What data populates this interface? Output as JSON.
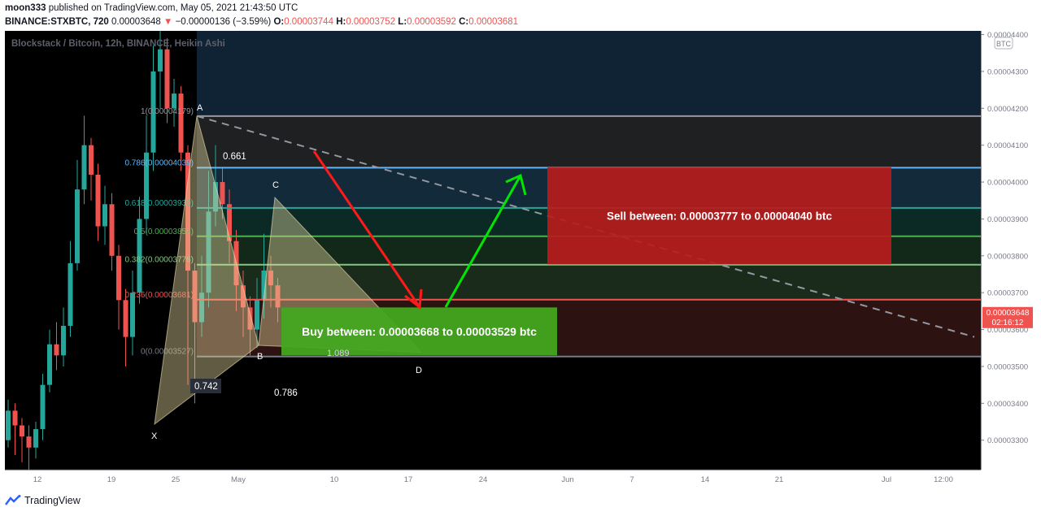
{
  "header": {
    "publisher": "moon333",
    "published_text": "published on TradingView.com, May 05, 2021 21:43:50 UTC",
    "symbol": "BINANCE:STXBTC, 720",
    "last": "0.00003648",
    "change": "−0.00000136 (−3.59%)",
    "o_label": "O:",
    "o": "0.00003744",
    "h_label": "H:",
    "h": "0.00003752",
    "l_label": "L:",
    "l": "0.00003592",
    "c_label": "C:",
    "c": "0.00003681"
  },
  "footer": {
    "brand": "TradingView"
  },
  "colors": {
    "up": "#26a69a",
    "down": "#ef5350",
    "buy": "#4caf50",
    "sell": "#c62828",
    "arrow_up": "#00e600",
    "arrow_down": "#ff1a1a"
  },
  "chart_data": {
    "type": "candlestick",
    "title": "Blockstack / Bitcoin, 12h, BINANCE, Heikin Ashi",
    "currency_badge": "BTC",
    "y_axis": {
      "range": [
        3.22e-05,
        4.41e-05
      ],
      "ticks": [
        "0.00003300",
        "0.00003400",
        "0.00003500",
        "0.00003600",
        "0.00003700",
        "0.00003800",
        "0.00003900",
        "0.00004000",
        "0.00004100",
        "0.00004200",
        "0.00004300",
        "0.00004400"
      ]
    },
    "x_axis": {
      "ticks": [
        "12",
        "19",
        "25",
        "May",
        "10",
        "17",
        "24",
        "Jun",
        "7",
        "14",
        "21",
        "Jul",
        "12:00"
      ]
    },
    "last_price_label": "0.00003648",
    "countdown_label": "02:16:12",
    "fib_levels": [
      {
        "label": "0.786(0.00004039)",
        "ratio": "0.786",
        "value": 4.039e-05,
        "color": "#64b5f6"
      },
      {
        "label": "0.618(0.00003930)",
        "ratio": "0.618",
        "value": 3.93e-05,
        "color": "#26a69a"
      },
      {
        "label": "0.5(0.00003853)",
        "ratio": "0.5",
        "value": 3.853e-05,
        "color": "#4caf50"
      },
      {
        "label": "0.382(0.00003776)",
        "ratio": "0.382",
        "value": 3.776e-05,
        "color": "#81c784"
      },
      {
        "label": "0.236(0.00003681)",
        "ratio": "0.236",
        "value": 3.681e-05,
        "color": "#ef5350"
      },
      {
        "label": "0(0.00003527)",
        "ratio": "0",
        "value": 3.527e-05,
        "color": "#787b86"
      }
    ],
    "fib_top_label": "1(0.00004179)",
    "fib_top_value": 4.179e-05,
    "pattern_points": [
      "X",
      "A",
      "B",
      "C",
      "D"
    ],
    "pattern_ratios": [
      "0.661",
      "0.742",
      "0.786",
      "1.089"
    ],
    "sell_label": "Sell between: 0.00003777 to 0.00004040 btc",
    "buy_label": "Buy between: 0.00003668 to 0.00003529 btc",
    "candles": [
      {
        "o": 3.3e-05,
        "c": 3.38e-05,
        "h": 3.41e-05,
        "l": 3.28e-05
      },
      {
        "o": 3.38e-05,
        "c": 3.34e-05,
        "h": 3.4e-05,
        "l": 3.26e-05
      },
      {
        "o": 3.34e-05,
        "c": 3.31e-05,
        "h": 3.36e-05,
        "l": 3.24e-05
      },
      {
        "o": 3.31e-05,
        "c": 3.28e-05,
        "h": 3.34e-05,
        "l": 3.22e-05
      },
      {
        "o": 3.28e-05,
        "c": 3.33e-05,
        "h": 3.35e-05,
        "l": 3.25e-05
      },
      {
        "o": 3.33e-05,
        "c": 3.45e-05,
        "h": 3.48e-05,
        "l": 3.3e-05
      },
      {
        "o": 3.45e-05,
        "c": 3.56e-05,
        "h": 3.6e-05,
        "l": 3.43e-05
      },
      {
        "o": 3.56e-05,
        "c": 3.53e-05,
        "h": 3.62e-05,
        "l": 3.49e-05
      },
      {
        "o": 3.53e-05,
        "c": 3.61e-05,
        "h": 3.66e-05,
        "l": 3.5e-05
      },
      {
        "o": 3.61e-05,
        "c": 3.78e-05,
        "h": 3.84e-05,
        "l": 3.58e-05
      },
      {
        "o": 3.78e-05,
        "c": 3.98e-05,
        "h": 4.06e-05,
        "l": 3.76e-05
      },
      {
        "o": 3.98e-05,
        "c": 4.1e-05,
        "h": 4.18e-05,
        "l": 3.94e-05
      },
      {
        "o": 4.1e-05,
        "c": 4.02e-05,
        "h": 4.12e-05,
        "l": 3.95e-05
      },
      {
        "o": 4.02e-05,
        "c": 3.88e-05,
        "h": 4.05e-05,
        "l": 3.84e-05
      },
      {
        "o": 3.88e-05,
        "c": 3.94e-05,
        "h": 3.99e-05,
        "l": 3.83e-05
      },
      {
        "o": 3.94e-05,
        "c": 3.8e-05,
        "h": 3.97e-05,
        "l": 3.76e-05
      },
      {
        "o": 3.8e-05,
        "c": 3.68e-05,
        "h": 3.83e-05,
        "l": 3.6e-05
      },
      {
        "o": 3.68e-05,
        "c": 3.58e-05,
        "h": 3.71e-05,
        "l": 3.5e-05
      },
      {
        "o": 3.58e-05,
        "c": 3.7e-05,
        "h": 3.76e-05,
        "l": 3.53e-05
      },
      {
        "o": 3.7e-05,
        "c": 3.9e-05,
        "h": 3.96e-05,
        "l": 3.67e-05
      },
      {
        "o": 3.9e-05,
        "c": 4.08e-05,
        "h": 4.18e-05,
        "l": 3.86e-05
      },
      {
        "o": 4.08e-05,
        "c": 4.3e-05,
        "h": 4.37e-05,
        "l": 4.03e-05
      },
      {
        "o": 4.3e-05,
        "c": 4.36e-05,
        "h": 4.41e-05,
        "l": 4.2e-05
      },
      {
        "o": 4.36e-05,
        "c": 4.2e-05,
        "h": 4.39e-05,
        "l": 4.16e-05
      },
      {
        "o": 4.2e-05,
        "c": 4.24e-05,
        "h": 4.28e-05,
        "l": 4.15e-05
      },
      {
        "o": 4.24e-05,
        "c": 4.08e-05,
        "h": 4.26e-05,
        "l": 4.03e-05
      },
      {
        "o": 4.08e-05,
        "c": 3.76e-05,
        "h": 4.1e-05,
        "l": 3.45e-05
      },
      {
        "o": 3.76e-05,
        "c": 3.62e-05,
        "h": 3.78e-05,
        "l": 3.4e-05
      },
      {
        "o": 3.62e-05,
        "c": 3.7e-05,
        "h": 3.8e-05,
        "l": 3.58e-05
      },
      {
        "o": 3.7e-05,
        "c": 3.92e-05,
        "h": 4.03e-05,
        "l": 3.66e-05
      },
      {
        "o": 3.92e-05,
        "c": 4e-05,
        "h": 4.1e-05,
        "l": 3.88e-05
      },
      {
        "o": 4e-05,
        "c": 3.94e-05,
        "h": 4.04e-05,
        "l": 3.9e-05
      },
      {
        "o": 3.94e-05,
        "c": 3.84e-05,
        "h": 3.98e-05,
        "l": 3.78e-05
      },
      {
        "o": 3.84e-05,
        "c": 3.72e-05,
        "h": 3.87e-05,
        "l": 3.65e-05
      },
      {
        "o": 3.72e-05,
        "c": 3.66e-05,
        "h": 3.76e-05,
        "l": 3.58e-05
      },
      {
        "o": 3.66e-05,
        "c": 3.6e-05,
        "h": 3.69e-05,
        "l": 3.53e-05
      },
      {
        "o": 3.6e-05,
        "c": 3.68e-05,
        "h": 3.74e-05,
        "l": 3.55e-05
      },
      {
        "o": 3.68e-05,
        "c": 3.76e-05,
        "h": 3.86e-05,
        "l": 3.63e-05
      },
      {
        "o": 3.76e-05,
        "c": 3.72e-05,
        "h": 3.8e-05,
        "l": 3.66e-05
      },
      {
        "o": 3.72e-05,
        "c": 3.66e-05,
        "h": 3.74e-05,
        "l": 3.62e-05
      }
    ]
  }
}
